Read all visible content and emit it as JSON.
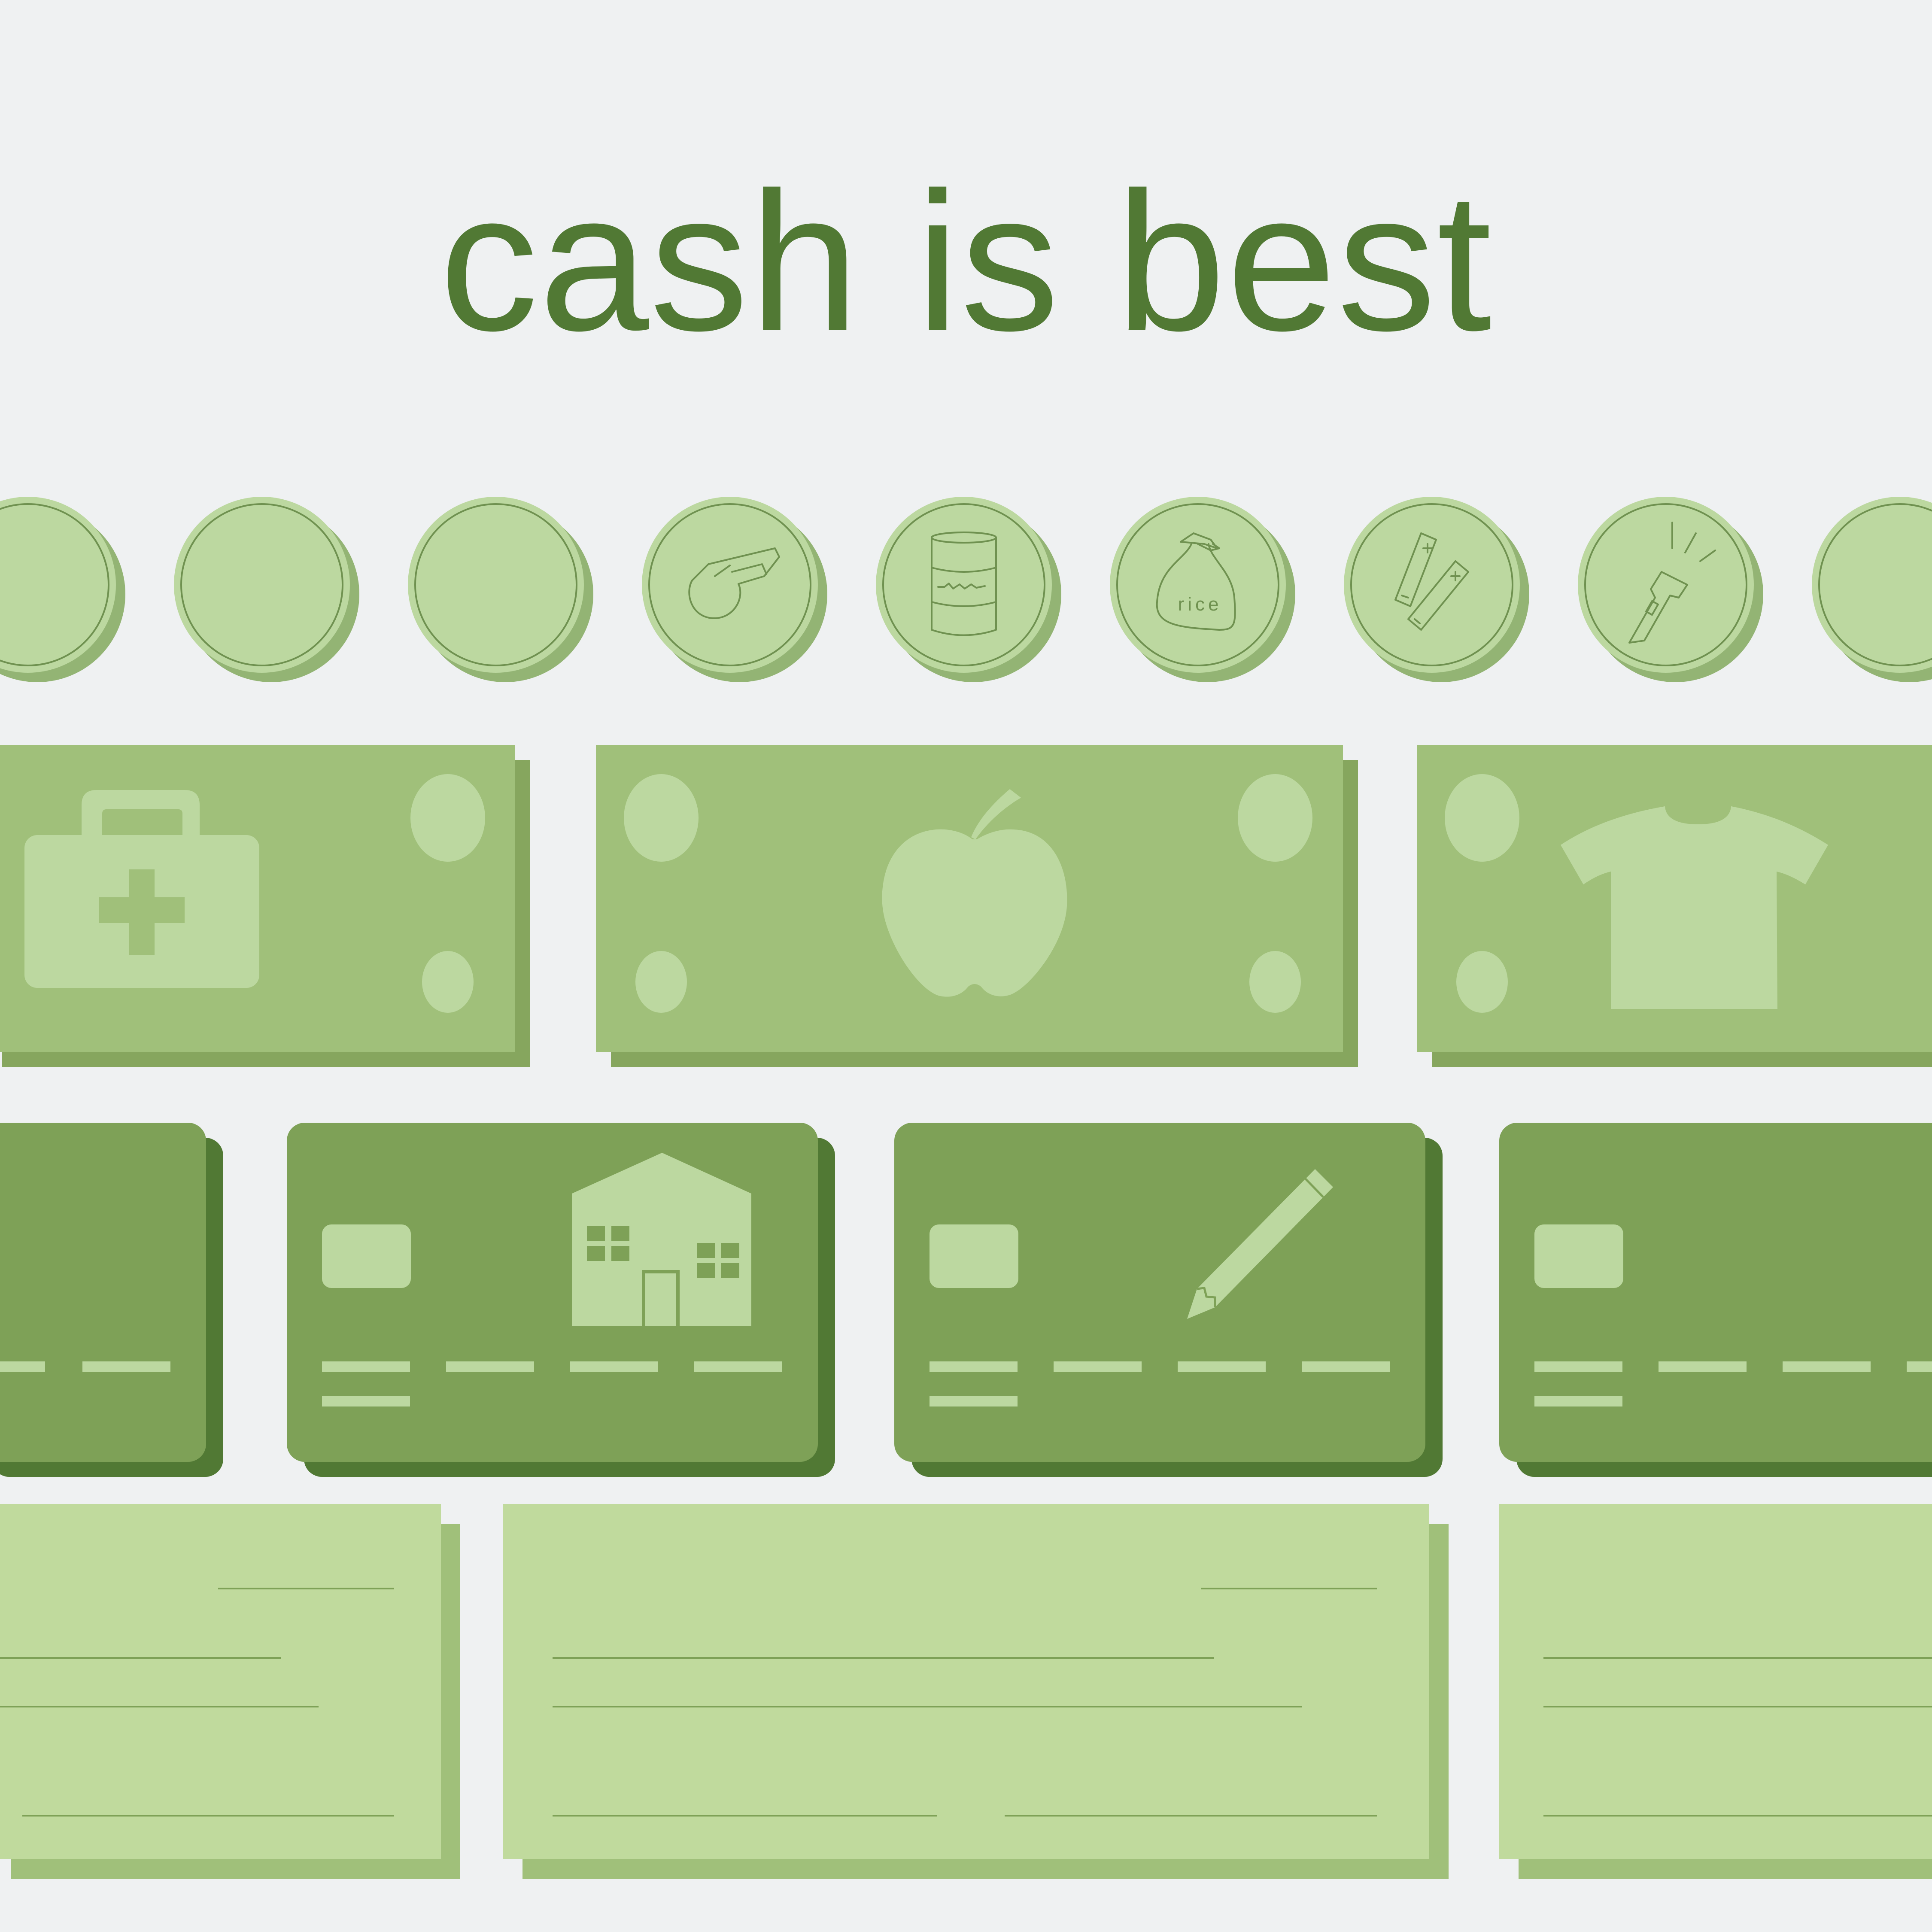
{
  "title": "cash is best",
  "colors": {
    "background": "#eff1f2",
    "title": "#517934",
    "coin_face": "#bcd8a0",
    "coin_shadow": "#93b474",
    "coin_outline": "#6f9150",
    "bill": "#a0c07a",
    "bill_shadow": "#86a65e",
    "bill_light": "#bcd8a0",
    "card": "#7ea157",
    "card_shadow": "#517934",
    "card_light": "#bcd8a0",
    "check": "#c0da9d",
    "check_shadow": "#a0c07a",
    "check_line": "#7ea157"
  },
  "coins": [
    {
      "icon": "blank-coin-icon",
      "label": ""
    },
    {
      "icon": "blank-coin-icon",
      "label": ""
    },
    {
      "icon": "blank-coin-icon",
      "label": ""
    },
    {
      "icon": "whistle-icon",
      "label": ""
    },
    {
      "icon": "canned-food-icon",
      "label": ""
    },
    {
      "icon": "rice-bag-icon",
      "label": "rice"
    },
    {
      "icon": "batteries-icon",
      "label": ""
    },
    {
      "icon": "flashlight-icon",
      "label": ""
    },
    {
      "icon": "blank-coin-icon",
      "label": ""
    }
  ],
  "bills": [
    {
      "icon": "first-aid-kit-icon"
    },
    {
      "icon": "apple-icon"
    },
    {
      "icon": "t-shirt-icon"
    }
  ],
  "cards": [
    {
      "icon": "none"
    },
    {
      "icon": "house-icon"
    },
    {
      "icon": "pencil-icon"
    },
    {
      "icon": "none"
    }
  ],
  "checks": [
    {
      "icon": "none"
    },
    {
      "icon": "none"
    },
    {
      "icon": "none"
    }
  ]
}
